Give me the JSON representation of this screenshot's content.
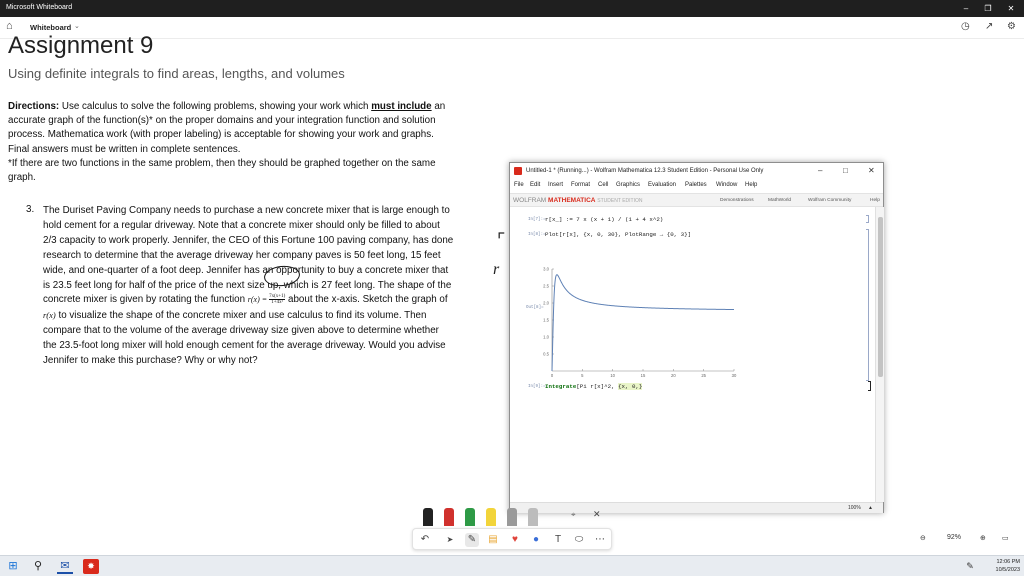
{
  "window": {
    "title": "Microsoft Whiteboard",
    "minimize": "–",
    "maximize": "❐",
    "close": "✕"
  },
  "appbar": {
    "home_icon": "home-icon",
    "label": "Whiteboard",
    "chevron": "⌄"
  },
  "document": {
    "title": "Assignment 9",
    "subtitle": "Using definite integrals to find areas, lengths, and volumes",
    "directions_lead": "Directions:",
    "directions_a": "  Use calculus to solve the following problems, showing your work which ",
    "directions_must": "must include",
    "directions_b": " an accurate graph of the function(s)* on the proper domains and your integration function and solution process.  Mathematica work (with proper labeling) is acceptable for showing your work and graphs.  Final answers must be written in complete sentences.",
    "directions_note": "*If there are two functions in the same problem, then they should be graphed together on the same graph.",
    "problem_number": "3.",
    "problem_a": "The Duriset Paving Company needs to purchase a new concrete mixer that is large enough to hold cement for a regular driveway.  Note that a concrete mixer should only be filled to about 2/3 capacity to work properly.  Jennifer, the CEO of this Fortune 100 paving company, has done research to determine that the average driveway her company paves is 50 feet long, 15 feet wide, and one-quarter of a foot deep.  Jennifer has an opportunity to buy a concrete mixer that is 23.5 feet long for half of the price of the next size up, which is 27 feet long.  The shape of the concrete mixer is given by rotating the function ",
    "func_lhs": "r(x) = ",
    "func_num": "7x(x+1)",
    "func_den": "1+4x²",
    "problem_b": " about the x-axis.  Sketch the graph of ",
    "func_ref": "r(x)",
    "problem_c": " to visualize the shape of the concrete mixer and use calculus to find its volume.  Then compare that to the volume of the average driveway size given above to determine whether the 23.5-foot long mixer will hold enough cement for the average driveway.  Would you advise Jennifer to make this purchase?  Why or why not?"
  },
  "mathematica": {
    "title": "Untitled-1 * (Running...) - Wolfram Mathematica 12.3 Student Edition - Personal Use Only",
    "menu": [
      "File",
      "Edit",
      "Insert",
      "Format",
      "Cell",
      "Graphics",
      "Evaluation",
      "Palettes",
      "Window",
      "Help"
    ],
    "brand_prefix": "WOLFRAM",
    "brand_name": "MATHEMATICA",
    "brand_edition": "STUDENT EDITION",
    "links": [
      "Demonstrations",
      "MathWorld",
      "Wolfram Community",
      "Help"
    ],
    "cells": [
      {
        "label": "In[7]:=",
        "code": "r[x_] := 7 x (x + 1) / (1 + 4 x^2)"
      },
      {
        "label": "In[8]:=",
        "code": "Plot[r[x], {x, 0, 30}, PlotRange → {0, 3}]"
      },
      {
        "label": "Out[8]=",
        "code": ""
      },
      {
        "label": "In[9]:=",
        "code_kw": "Integrate",
        "code_rest": "[Pi r[x]^2, ",
        "code_hl": "{x, 0,}"
      }
    ],
    "zoom": "100%",
    "zoom_arrow": "▲"
  },
  "chart_data": {
    "type": "line",
    "title": "",
    "xlabel": "",
    "ylabel": "",
    "xlim": [
      0,
      30
    ],
    "ylim": [
      0,
      3
    ],
    "xticks": [
      "0",
      "5",
      "10",
      "15",
      "20",
      "25",
      "30"
    ],
    "yticks": [
      "0.5",
      "1.0",
      "1.5",
      "2.0",
      "2.5",
      "3.0"
    ],
    "series": [
      {
        "color": "#5e81b5",
        "function": "7x(x+1)/(1+4x^2)"
      }
    ]
  },
  "toolbar": {
    "tools": [
      "undo-icon",
      "select-icon",
      "pen-icon",
      "sticky-note-icon",
      "reactions-icon",
      "shapes-icon",
      "text-icon",
      "lasso-icon",
      "more-icon"
    ],
    "undo": "↶",
    "select": "➤",
    "pen": "✎",
    "note": "▤",
    "heart": "♥",
    "shape": "●",
    "text": "T",
    "lasso": "⬭",
    "more": "⋯",
    "pen_colors": [
      "#222222",
      "#d0312d",
      "#2e9a46",
      "#f2d43a",
      "#9a9a9a",
      "#bcbcbc"
    ]
  },
  "zoom_control": {
    "zoom_out": "⊖",
    "value": "92%",
    "zoom_in": "⊕",
    "fit": "▭"
  },
  "taskbar": {
    "clock_time": "12:06 PM",
    "clock_date": "10/5/2023"
  }
}
